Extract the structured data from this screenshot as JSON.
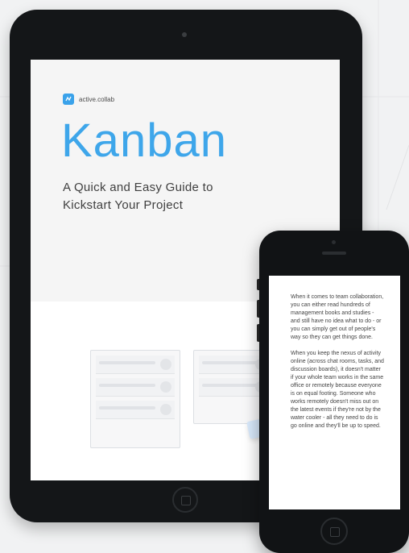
{
  "tablet": {
    "brand": "active.collab",
    "title": "Kanban",
    "subtitle": "A Quick and Easy Guide to\nKickstart Your Project"
  },
  "phone": {
    "paragraphs": [
      "When it comes to team collaboration, you can either read hundreds of management books and studies - and still have no idea what to do - or you can simply get out of people's way so they can get things done.",
      "When you keep the nexus of activity online (across chat rooms, tasks, and discussion boards), it doesn't matter if your whole team works in the same office or remotely because everyone is on equal footing. Someone who works remotely doesn't miss out on the latest events if they're not by the water cooler - all they need to do is go online and they'll be up to speed."
    ]
  },
  "colors": {
    "accent": "#3ea6ea",
    "device": "#141618",
    "background": "#f1f2f3"
  },
  "icons": [
    "activecollab-logo-icon",
    "tablet-home-button-icon",
    "phone-home-button-icon"
  ]
}
